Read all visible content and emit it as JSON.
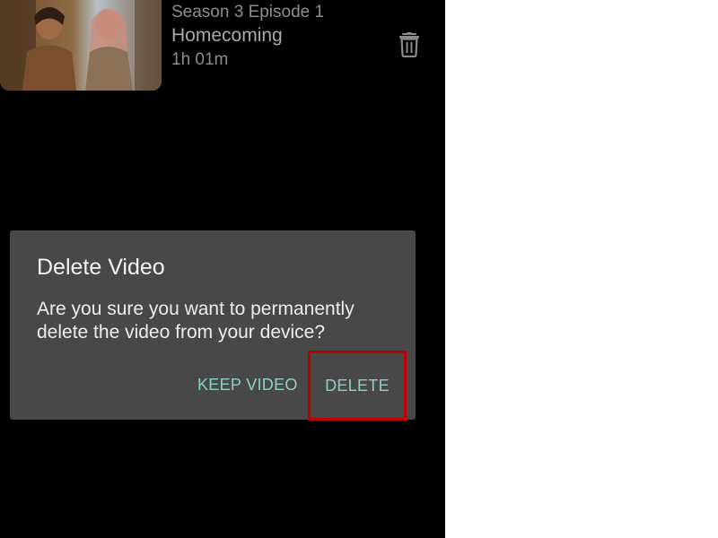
{
  "episode": {
    "season_episode": "Season 3 Episode 1",
    "title": "Homecoming",
    "duration": "1h 01m",
    "delete_icon": "trash-icon"
  },
  "dialog": {
    "title": "Delete Video",
    "message": "Are you sure you want to permanently delete the video from your device?",
    "keep_label": "KEEP VIDEO",
    "delete_label": "DELETE"
  },
  "colors": {
    "background": "#000000",
    "dialog_bg": "#484848",
    "accent": "#8ccfc7",
    "highlight_border": "#c00000"
  }
}
